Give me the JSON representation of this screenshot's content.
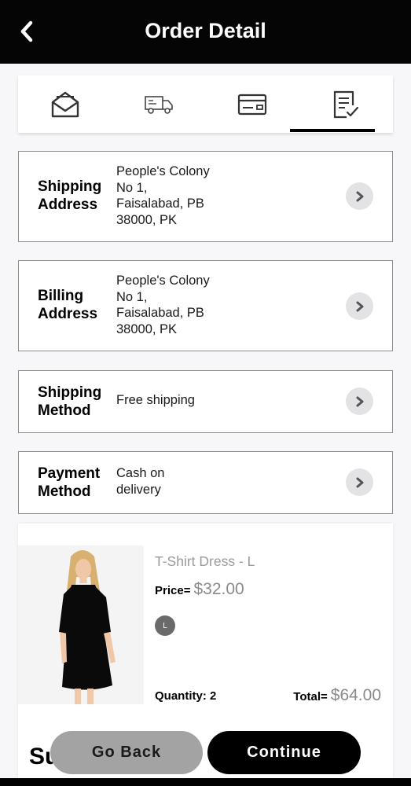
{
  "header": {
    "title": "Order Detail",
    "back_icon": "chevron-left-icon"
  },
  "tabs": [
    {
      "icon": "envelope-open-icon",
      "active": false
    },
    {
      "icon": "delivery-truck-icon",
      "active": false
    },
    {
      "icon": "credit-card-icon",
      "active": false
    },
    {
      "icon": "checklist-icon",
      "active": true
    }
  ],
  "shipping_address": {
    "label_line1": "Shipping",
    "label_line2": "Address",
    "lines": [
      "People's Colony",
      "No 1,",
      "Faisalabad, PB",
      "38000, PK"
    ]
  },
  "billing_address": {
    "label_line1": "Billing",
    "label_line2": "Address",
    "lines": [
      "People's Colony",
      "No 1,",
      "Faisalabad, PB",
      "38000, PK"
    ]
  },
  "shipping_method": {
    "label_line1": "Shipping",
    "label_line2": "Method",
    "value": "Free shipping"
  },
  "payment_method": {
    "label_line1": "Payment",
    "label_line2": "Method",
    "value_line1": "Cash on",
    "value_line2": "delivery"
  },
  "product": {
    "name": "T-Shirt Dress - L",
    "price_label": "Price=",
    "price": "$32.00",
    "size": "L",
    "quantity": "Quantity: 2",
    "total_label": "Total=",
    "total": "$64.00"
  },
  "summary_title": "Su",
  "buttons": {
    "back": "Go Back",
    "continue": "Continue"
  },
  "colors": {
    "header_bg": "#050505",
    "accent": "#000000",
    "muted_price": "#8a8a8a",
    "secondary_button": "#a3a3a3"
  }
}
